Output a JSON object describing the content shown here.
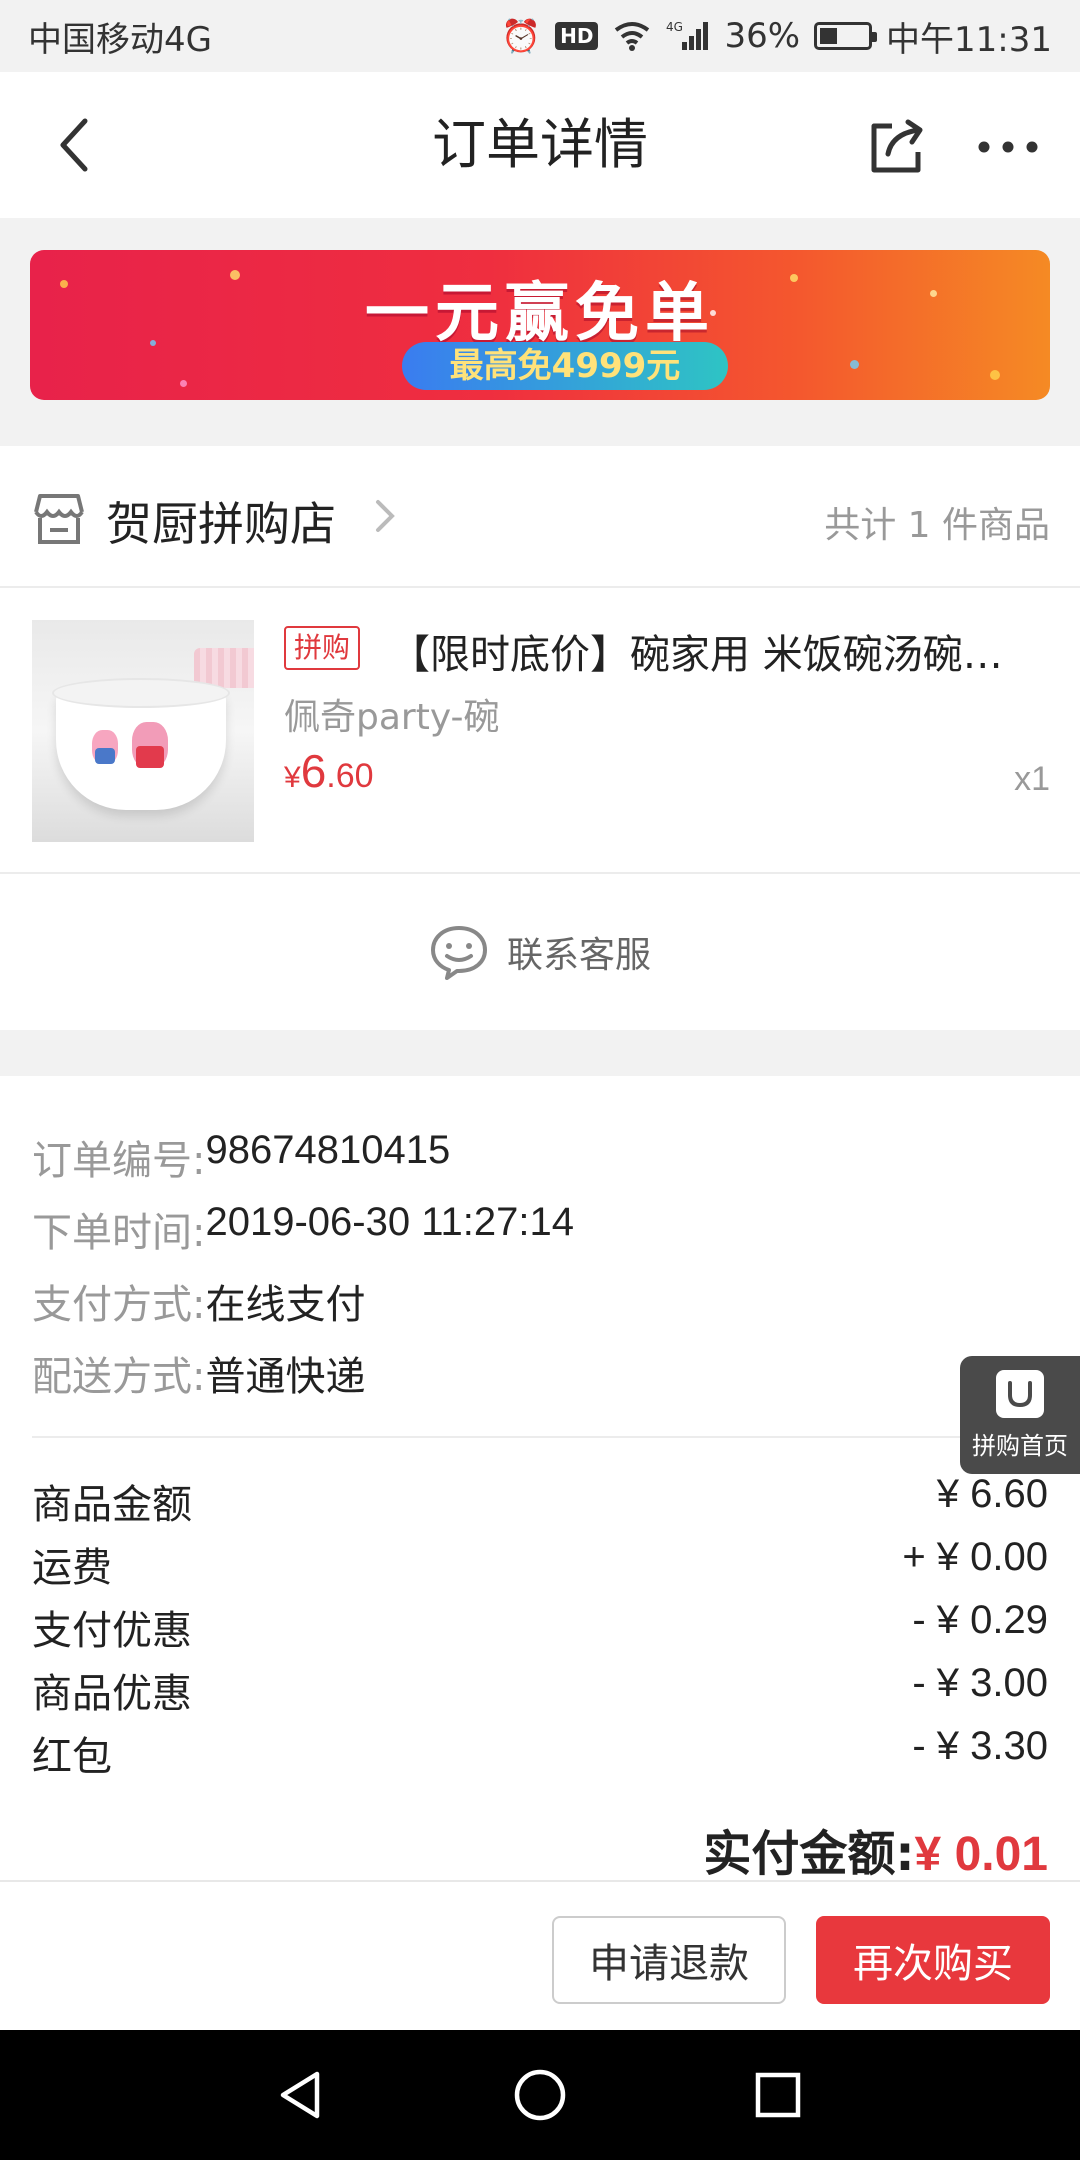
{
  "status_bar": {
    "carrier": "中国移动4G",
    "network": "4G",
    "battery": "36%",
    "battery_level": 0.36,
    "time": "中午11:31",
    "icons": [
      "alarm-icon",
      "hd-icon",
      "wifi-icon",
      "signal-icon",
      "battery-icon"
    ],
    "hd_label": "HD"
  },
  "nav": {
    "title": "订单详情",
    "icons": [
      "back-icon",
      "share-icon",
      "more-icon"
    ]
  },
  "banner": {
    "title": "一元赢免单",
    "subtitle": "最高免4999元"
  },
  "shop": {
    "name": "贺厨拼购店",
    "count_text": "共计 1 件商品"
  },
  "product": {
    "tag": "拼购",
    "title": "【限时底价】碗家用 米饭碗汤碗…",
    "spec": "佩奇party-碗",
    "price_currency": "¥",
    "price_int": "6",
    "price_dec": ".60",
    "quantity": "x1"
  },
  "contact": {
    "label": "联系客服"
  },
  "order_info": {
    "number_label": "订单编号:",
    "number": "98674810415",
    "time_label": "下单时间:",
    "time": "2019-06-30 11:27:14",
    "payment_label": "支付方式:",
    "payment": "在线支付",
    "delivery_label": "配送方式:",
    "delivery": "普通快递"
  },
  "fees": [
    {
      "label": "商品金额",
      "value": "¥ 6.60"
    },
    {
      "label": "运费",
      "value": "+ ¥ 0.00"
    },
    {
      "label": "支付优惠",
      "value": "- ¥ 0.29"
    },
    {
      "label": "商品优惠",
      "value": "- ¥ 3.00"
    },
    {
      "label": "红包",
      "value": "- ¥ 3.30"
    }
  ],
  "total": {
    "label": "实付金额:",
    "amount": "¥ 0.01"
  },
  "float_home": {
    "label": "拼购首页"
  },
  "actions": {
    "refund": "申请退款",
    "rebuy": "再次购买"
  },
  "colors": {
    "accent": "#e0393e",
    "button_red": "#e8383d",
    "banner_start": "#e8224a",
    "banner_end": "#f58a24"
  }
}
